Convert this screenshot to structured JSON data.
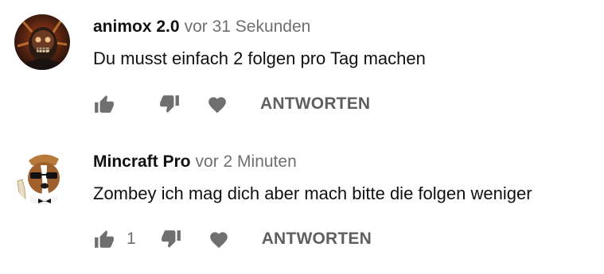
{
  "comments": [
    {
      "author": "animox 2.0",
      "timestamp": "vor 31 Sekunden",
      "text": "Du musst einfach 2 folgen pro Tag machen",
      "like_count": "",
      "reply_label": "ANTWORTEN"
    },
    {
      "author": "Mincraft Pro",
      "timestamp": "vor 2 Minuten",
      "text": "Zombey ich mag dich aber mach bitte die folgen weniger",
      "like_count": "1",
      "reply_label": "ANTWORTEN"
    }
  ],
  "colors": {
    "icon": "#6f6f6f",
    "author": "#111111",
    "muted": "#6f6f6f"
  },
  "icons": [
    "thumb-up-icon",
    "thumb-down-icon",
    "heart-icon"
  ]
}
